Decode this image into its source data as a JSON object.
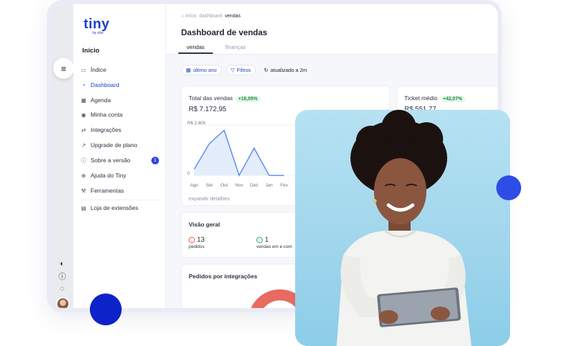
{
  "brand": {
    "logo": "tiny",
    "logo_sub": "by olist"
  },
  "sidebar": {
    "title": "Início",
    "items": [
      {
        "label": "Índice",
        "icon": "map-icon"
      },
      {
        "label": "Dashboard",
        "icon": "dashboard-icon",
        "active": true
      },
      {
        "label": "Agenda",
        "icon": "calendar-icon"
      },
      {
        "label": "Minha conta",
        "icon": "user-icon"
      },
      {
        "label": "Integrações",
        "icon": "swap-icon"
      },
      {
        "label": "Upgrade de plano",
        "icon": "rocket-icon"
      },
      {
        "label": "Sobre a versão",
        "icon": "info-icon",
        "badge": "1"
      },
      {
        "label": "Ajuda do Tiny",
        "icon": "globe-icon"
      },
      {
        "label": "Ferramentas",
        "icon": "wrench-icon"
      },
      {
        "label": "Loja de extensões",
        "icon": "store-icon"
      }
    ]
  },
  "breadcrumb": {
    "home": "início",
    "section": "dashboard",
    "current": "vendas"
  },
  "page": {
    "title": "Dashboard de vendas"
  },
  "tabs": [
    {
      "label": "vendas",
      "active": true
    },
    {
      "label": "finanças"
    }
  ],
  "filters": {
    "period": "último ano",
    "filters": "Filtros",
    "updated": "atualizado a 2m"
  },
  "sales_card": {
    "title": "Total das vendas",
    "delta": "+16,05%",
    "value": "R$ 7.172,95",
    "expand": "expandir detalhes"
  },
  "ticket_card": {
    "title": "Ticket médio",
    "delta": "+42,07%",
    "value": "R$ 551,77"
  },
  "overview": {
    "title": "Visão geral",
    "stat1_value": "13",
    "stat1_label": "pedidos",
    "stat2_value": "1",
    "stat2_label": "vendas em e-com"
  },
  "integrations": {
    "title": "Pedidos por integrações"
  },
  "colors": {
    "brand": "#1a3fc4",
    "accent_blue": "#2f44e0",
    "chart_line": "#5b8ff0",
    "chart_fill": "#dce8fb",
    "donut": "#e86a60",
    "positive": "#1c8c40"
  },
  "chart_data": {
    "type": "area",
    "categories": [
      "Ago",
      "Set",
      "Out",
      "Nov",
      "Dez",
      "Jan",
      "Fev"
    ],
    "values": [
      300,
      1500,
      2150,
      0,
      1300,
      0,
      0
    ],
    "ytick_labels": [
      "R$ 2.400",
      "0"
    ],
    "ylim": [
      0,
      2400
    ]
  }
}
